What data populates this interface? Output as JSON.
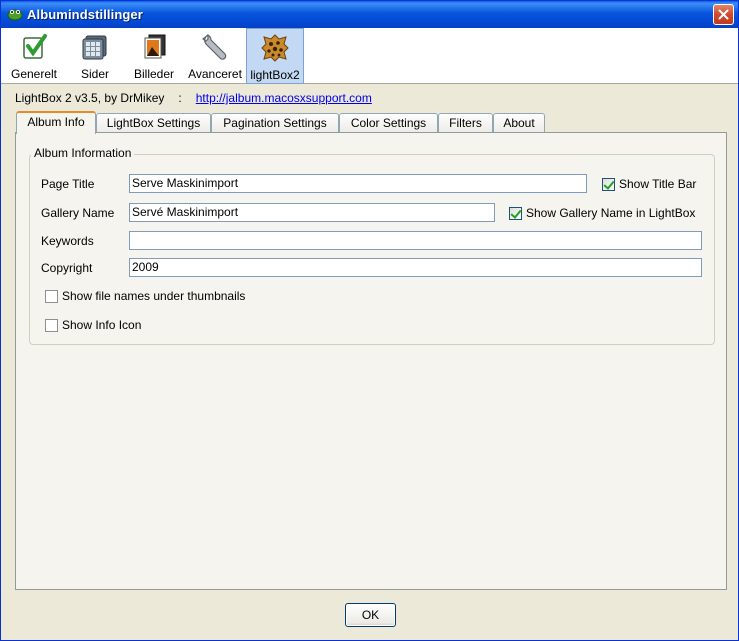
{
  "window": {
    "title": "Albumindstillinger"
  },
  "toolbar": {
    "items": [
      {
        "label": "Generelt",
        "icon": "check-clipboard-icon"
      },
      {
        "label": "Sider",
        "icon": "pages-grid-icon"
      },
      {
        "label": "Billeder",
        "icon": "images-icon"
      },
      {
        "label": "Avanceret",
        "icon": "wrench-icon"
      },
      {
        "label": "lightBox2",
        "icon": "leopard-skin-icon"
      }
    ],
    "active_index": 4
  },
  "info": {
    "text": "LightBox 2 v3.5, by DrMikey",
    "separator": ":",
    "link": "http://jalbum.macosxsupport.com"
  },
  "tabs": [
    "Album Info",
    "LightBox Settings",
    "Pagination Settings",
    "Color Settings",
    "Filters",
    "About"
  ],
  "active_tab": "Album Info",
  "album_info": {
    "group_title": "Album Information",
    "page_title_label": "Page Title",
    "page_title_value": "Serve Maskinimport",
    "show_title_bar_label": "Show Title Bar",
    "show_title_bar_checked": true,
    "gallery_name_label": "Gallery Name",
    "gallery_name_value": "Servé Maskinimport",
    "show_gallery_name_label": "Show Gallery Name in LightBox",
    "show_gallery_name_checked": true,
    "keywords_label": "Keywords",
    "keywords_value": "",
    "copyright_label": "Copyright",
    "copyright_value": "2009",
    "show_file_names_label": "Show file names under thumbnails",
    "show_file_names_checked": false,
    "show_info_icon_label": "Show Info Icon",
    "show_info_icon_checked": false
  },
  "buttons": {
    "ok": "OK"
  },
  "colors": {
    "titlebar": "#0855dd",
    "active_tab_accent": "#e68b2c",
    "link": "#0000ee"
  }
}
